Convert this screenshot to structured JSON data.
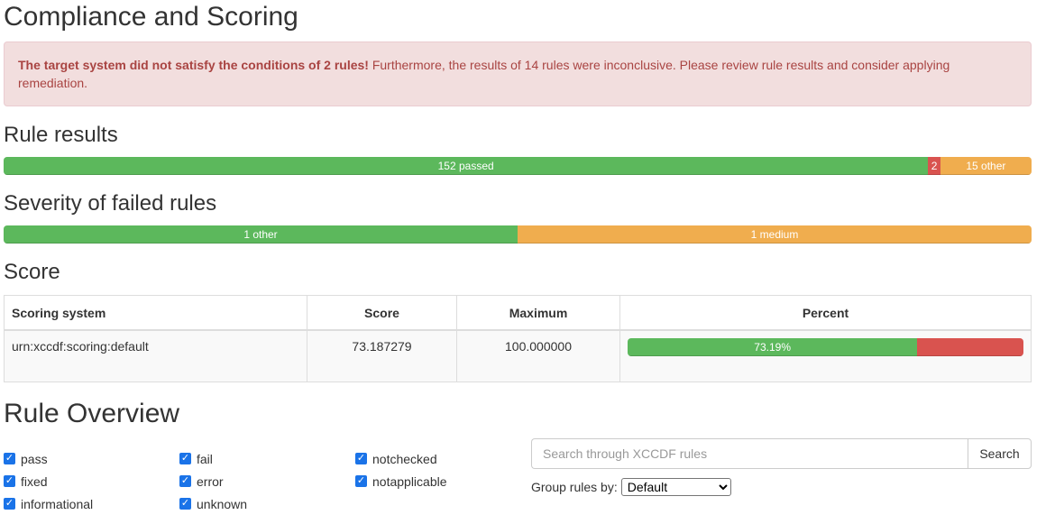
{
  "compliance": {
    "title": "Compliance and Scoring",
    "alert_strong": "The target system did not satisfy the conditions of 2 rules!",
    "alert_text": " Furthermore, the results of 14 rules were inconclusive. Please review rule results and consider applying remediation."
  },
  "rule_results": {
    "title": "Rule results",
    "segments": [
      {
        "label": "152 passed",
        "count": 152,
        "kind": "success"
      },
      {
        "label": "2",
        "count": 2,
        "kind": "danger"
      },
      {
        "label": "15 other",
        "count": 15,
        "kind": "warning"
      }
    ]
  },
  "severity": {
    "title": "Severity of failed rules",
    "segments": [
      {
        "label": "1 other",
        "count": 1,
        "kind": "success"
      },
      {
        "label": "1 medium",
        "count": 1,
        "kind": "warning"
      }
    ]
  },
  "score": {
    "title": "Score",
    "headers": {
      "system": "Scoring system",
      "score": "Score",
      "maximum": "Maximum",
      "percent": "Percent"
    },
    "rows": [
      {
        "system": "urn:xccdf:scoring:default",
        "score": "73.187279",
        "maximum": "100.000000",
        "percent_label": "73.19%",
        "percent": 73.19
      }
    ]
  },
  "overview": {
    "title": "Rule Overview",
    "filters": [
      {
        "label": "pass",
        "checked": true
      },
      {
        "label": "fail",
        "checked": true
      },
      {
        "label": "notchecked",
        "checked": true
      },
      {
        "label": "fixed",
        "checked": true
      },
      {
        "label": "error",
        "checked": true
      },
      {
        "label": "notapplicable",
        "checked": true
      },
      {
        "label": "informational",
        "checked": true
      },
      {
        "label": "unknown",
        "checked": true
      }
    ],
    "search_placeholder": "Search through XCCDF rules",
    "search_button": "Search",
    "group_label": "Group rules by:",
    "group_value": "Default"
  },
  "colors": {
    "success": "#5cb85c",
    "danger": "#d9534f",
    "warning": "#f0ad4e",
    "checkbox": "#1a73e8"
  }
}
